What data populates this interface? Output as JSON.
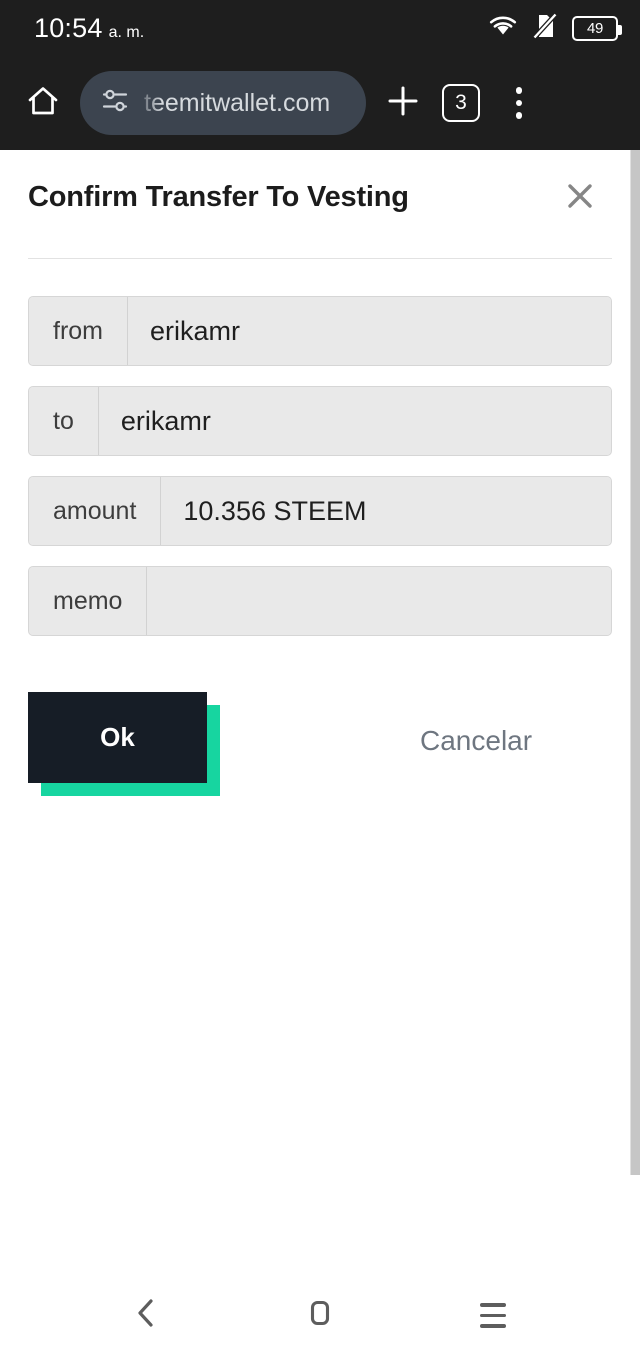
{
  "status_bar": {
    "time": "10:54",
    "period": "a. m.",
    "battery_level": "49",
    "icons": [
      "wifi-icon",
      "no-sim-icon",
      "battery-icon"
    ]
  },
  "browser": {
    "home_icon": "home-icon",
    "site_settings_icon": "site-settings-icon",
    "url": "teemitwallet.com",
    "new_tab_icon": "plus-icon",
    "tab_count": "3",
    "menu_icon": "kebab-menu-icon"
  },
  "dialog": {
    "title": "Confirm Transfer To Vesting",
    "close_label": "×",
    "fields": [
      {
        "label": "from",
        "value": "erikamr"
      },
      {
        "label": "to",
        "value": "erikamr"
      },
      {
        "label": "amount",
        "value": "10.356 STEEM"
      },
      {
        "label": "memo",
        "value": ""
      }
    ],
    "ok_label": "Ok",
    "cancel_label": "Cancelar",
    "colors": {
      "accent_green": "#17d5a0",
      "button_dark": "#161d26",
      "cancel_text": "#6e7680",
      "field_bg": "#e9e9e9"
    }
  },
  "nav_bar": {
    "back_icon": "back-chevron-icon",
    "home_icon": "home-square-icon",
    "recents_icon": "recents-icon"
  }
}
